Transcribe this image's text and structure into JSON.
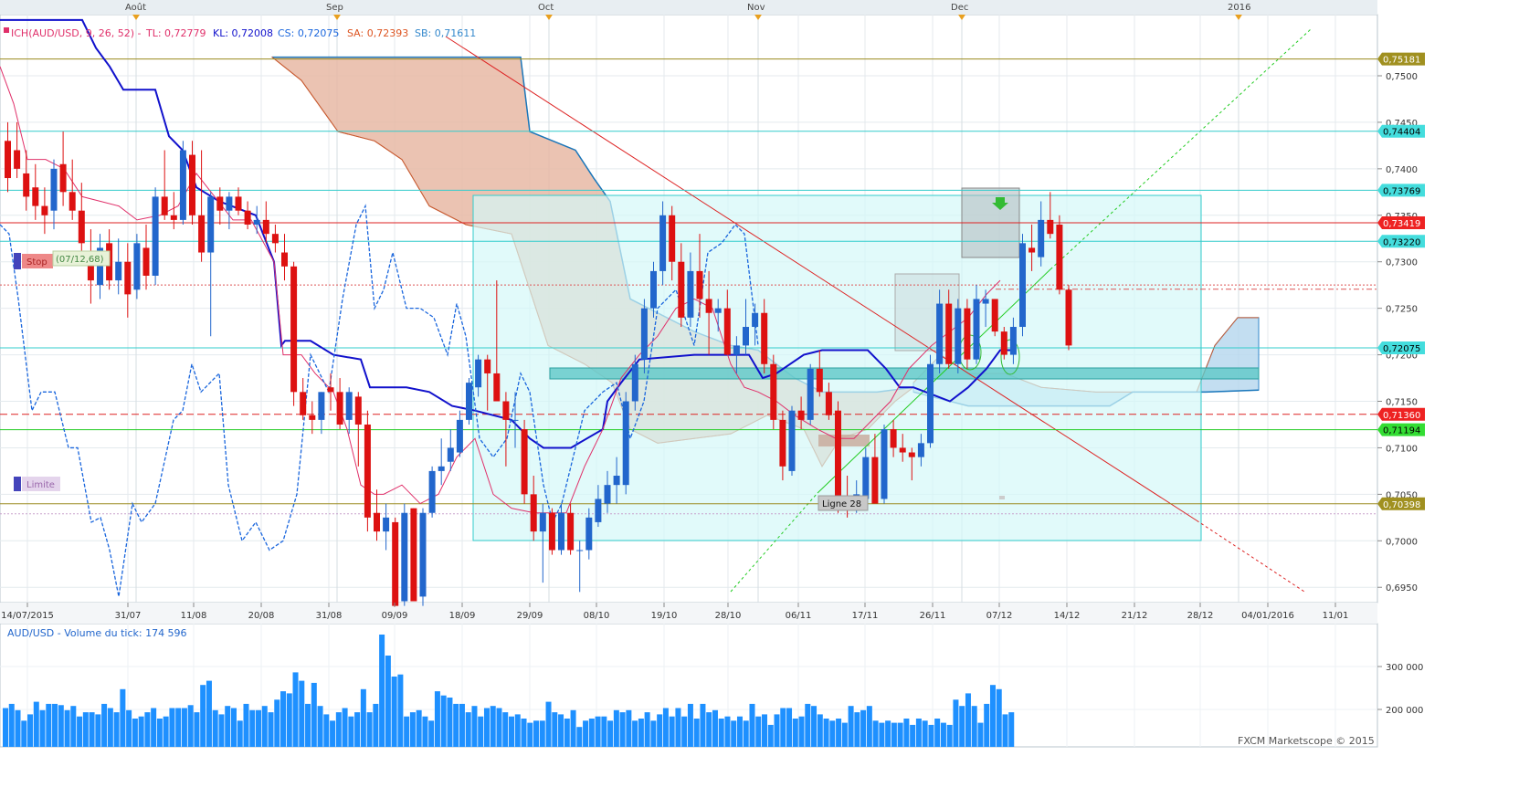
{
  "chart_data": {
    "type": "candlestick",
    "title": "ICH(AUD/USD, 9, 26, 52)",
    "indicator_readout": {
      "title": "ICH(AUD/USD, 9, 26, 52) -",
      "tl": "TL: 0,72779",
      "kl": "KL: 0,72008",
      "cs": "CS: 0,72075",
      "sa": "SA: 0,72393",
      "sb": "SB: 0,71611"
    },
    "month_labels": [
      "Août",
      "Sep",
      "Oct",
      "Nov",
      "Dec",
      "2016"
    ],
    "x_tick_labels": [
      "14/07/2015",
      "31/07",
      "11/08",
      "20/08",
      "31/08",
      "09/09",
      "18/09",
      "29/09",
      "08/10",
      "19/10",
      "28/10",
      "06/11",
      "17/11",
      "26/11",
      "07/12",
      "14/12",
      "21/12",
      "28/12",
      "04/01/2016",
      "11/01"
    ],
    "y_tick_labels": [
      "0,7500",
      "0,7450",
      "0,7400",
      "0,7350",
      "0,7300",
      "0,7250",
      "0,7200",
      "0,7150",
      "0,7100",
      "0,7050",
      "0,7000",
      "0,6950"
    ],
    "ylim": [
      0.6925,
      0.7545
    ],
    "price_levels": [
      {
        "value": 0.75181,
        "label": "0,75181",
        "color": "#9a8a1e"
      },
      {
        "value": 0.74404,
        "label": "0,74404",
        "color": "#33cccc"
      },
      {
        "value": 0.73769,
        "label": "0,73769",
        "color": "#33cccc"
      },
      {
        "value": 0.73419,
        "label": "0,73419",
        "color": "#dd2222"
      },
      {
        "value": 0.7322,
        "label": "0,73220",
        "color": "#33cccc"
      },
      {
        "value": 0.72075,
        "label": "0,72075",
        "color": "#33cccc"
      },
      {
        "value": 0.7136,
        "label": "0,71360",
        "color": "#dd2222"
      },
      {
        "value": 0.71194,
        "label": "0,71194",
        "color": "#22cc22"
      },
      {
        "value": 0.70398,
        "label": "0,70398",
        "color": "#9a8a1e"
      }
    ],
    "candles": [
      [
        0.743,
        0.745,
        0.7375,
        0.739
      ],
      [
        0.742,
        0.745,
        0.739,
        0.74
      ],
      [
        0.7395,
        0.742,
        0.7355,
        0.737
      ],
      [
        0.738,
        0.7405,
        0.7345,
        0.736
      ],
      [
        0.736,
        0.738,
        0.733,
        0.735
      ],
      [
        0.7355,
        0.741,
        0.7335,
        0.74
      ],
      [
        0.7405,
        0.744,
        0.736,
        0.7375
      ],
      [
        0.7375,
        0.741,
        0.7345,
        0.7355
      ],
      [
        0.7355,
        0.7385,
        0.73,
        0.732
      ],
      [
        0.731,
        0.7335,
        0.7255,
        0.728
      ],
      [
        0.7275,
        0.733,
        0.726,
        0.7315
      ],
      [
        0.732,
        0.7335,
        0.727,
        0.728
      ],
      [
        0.728,
        0.7325,
        0.7265,
        0.73
      ],
      [
        0.73,
        0.732,
        0.724,
        0.7265
      ],
      [
        0.727,
        0.733,
        0.726,
        0.732
      ],
      [
        0.7315,
        0.734,
        0.727,
        0.7285
      ],
      [
        0.7285,
        0.738,
        0.7275,
        0.737
      ],
      [
        0.737,
        0.742,
        0.7345,
        0.735
      ],
      [
        0.735,
        0.7375,
        0.7335,
        0.7345
      ],
      [
        0.7345,
        0.743,
        0.734,
        0.742
      ],
      [
        0.7415,
        0.743,
        0.734,
        0.735
      ],
      [
        0.735,
        0.742,
        0.73,
        0.731
      ],
      [
        0.731,
        0.7375,
        0.722,
        0.737
      ],
      [
        0.737,
        0.738,
        0.734,
        0.7355
      ],
      [
        0.7355,
        0.7375,
        0.7335,
        0.737
      ],
      [
        0.737,
        0.738,
        0.735,
        0.7355
      ],
      [
        0.7355,
        0.7365,
        0.7335,
        0.734
      ],
      [
        0.734,
        0.736,
        0.733,
        0.7345
      ],
      [
        0.7345,
        0.7365,
        0.732,
        0.733
      ],
      [
        0.733,
        0.734,
        0.731,
        0.732
      ],
      [
        0.731,
        0.733,
        0.728,
        0.7295
      ],
      [
        0.7295,
        0.73,
        0.7145,
        0.716
      ],
      [
        0.716,
        0.7175,
        0.713,
        0.7135
      ],
      [
        0.7135,
        0.715,
        0.7115,
        0.713
      ],
      [
        0.713,
        0.716,
        0.7115,
        0.716
      ],
      [
        0.7165,
        0.718,
        0.714,
        0.716
      ],
      [
        0.716,
        0.7175,
        0.712,
        0.7125
      ],
      [
        0.713,
        0.7165,
        0.7115,
        0.716
      ],
      [
        0.7155,
        0.716,
        0.708,
        0.7125
      ],
      [
        0.7125,
        0.714,
        0.701,
        0.7025
      ],
      [
        0.703,
        0.7055,
        0.7,
        0.701
      ],
      [
        0.701,
        0.704,
        0.699,
        0.7025
      ],
      [
        0.702,
        0.7025,
        0.693,
        0.693
      ],
      [
        0.6935,
        0.704,
        0.693,
        0.703
      ],
      [
        0.7035,
        0.7035,
        0.6935,
        0.6935
      ],
      [
        0.694,
        0.7035,
        0.693,
        0.703
      ],
      [
        0.703,
        0.708,
        0.7025,
        0.7075
      ],
      [
        0.7075,
        0.711,
        0.706,
        0.708
      ],
      [
        0.7085,
        0.712,
        0.7075,
        0.71
      ],
      [
        0.7095,
        0.714,
        0.709,
        0.713
      ],
      [
        0.713,
        0.7175,
        0.7125,
        0.717
      ],
      [
        0.7165,
        0.72,
        0.7155,
        0.7195
      ],
      [
        0.7195,
        0.72,
        0.714,
        0.718
      ],
      [
        0.718,
        0.728,
        0.717,
        0.715
      ],
      [
        0.715,
        0.716,
        0.708,
        0.713
      ],
      [
        0.713,
        0.716,
        0.71,
        0.713
      ],
      [
        0.712,
        0.713,
        0.704,
        0.705
      ],
      [
        0.705,
        0.707,
        0.7,
        0.701
      ],
      [
        0.701,
        0.704,
        0.6955,
        0.703
      ],
      [
        0.703,
        0.7035,
        0.6985,
        0.699
      ],
      [
        0.699,
        0.704,
        0.6985,
        0.703
      ],
      [
        0.703,
        0.704,
        0.6985,
        0.699
      ],
      [
        0.699,
        0.7,
        0.6945,
        0.699
      ],
      [
        0.699,
        0.7035,
        0.698,
        0.7025
      ],
      [
        0.702,
        0.706,
        0.7015,
        0.7045
      ],
      [
        0.704,
        0.7075,
        0.703,
        0.706
      ],
      [
        0.706,
        0.709,
        0.704,
        0.707
      ],
      [
        0.706,
        0.716,
        0.705,
        0.715
      ],
      [
        0.715,
        0.72,
        0.714,
        0.719
      ],
      [
        0.7195,
        0.726,
        0.718,
        0.725
      ],
      [
        0.725,
        0.73,
        0.724,
        0.729
      ],
      [
        0.729,
        0.7365,
        0.7275,
        0.735
      ],
      [
        0.735,
        0.736,
        0.728,
        0.73
      ],
      [
        0.73,
        0.732,
        0.723,
        0.724
      ],
      [
        0.724,
        0.731,
        0.723,
        0.729
      ],
      [
        0.729,
        0.733,
        0.724,
        0.726
      ],
      [
        0.726,
        0.729,
        0.72,
        0.7245
      ],
      [
        0.7245,
        0.726,
        0.7225,
        0.725
      ],
      [
        0.725,
        0.727,
        0.72,
        0.72
      ],
      [
        0.72,
        0.722,
        0.718,
        0.721
      ],
      [
        0.721,
        0.726,
        0.72,
        0.723
      ],
      [
        0.723,
        0.7255,
        0.721,
        0.7245
      ],
      [
        0.7245,
        0.726,
        0.718,
        0.719
      ],
      [
        0.719,
        0.72,
        0.712,
        0.713
      ],
      [
        0.713,
        0.714,
        0.7065,
        0.708
      ],
      [
        0.7075,
        0.7145,
        0.707,
        0.714
      ],
      [
        0.714,
        0.7155,
        0.712,
        0.713
      ],
      [
        0.713,
        0.719,
        0.7125,
        0.7185
      ],
      [
        0.7185,
        0.7205,
        0.7155,
        0.716
      ],
      [
        0.716,
        0.717,
        0.713,
        0.7135
      ],
      [
        0.714,
        0.715,
        0.703,
        0.7045
      ],
      [
        0.7045,
        0.707,
        0.7025,
        0.7035
      ],
      [
        0.7035,
        0.7065,
        0.703,
        0.705
      ],
      [
        0.7045,
        0.71,
        0.704,
        0.709
      ],
      [
        0.709,
        0.7115,
        0.704,
        0.704
      ],
      [
        0.7045,
        0.7125,
        0.704,
        0.712
      ],
      [
        0.712,
        0.713,
        0.709,
        0.71
      ],
      [
        0.71,
        0.7115,
        0.7085,
        0.7095
      ],
      [
        0.7095,
        0.71,
        0.7065,
        0.709
      ],
      [
        0.709,
        0.7115,
        0.708,
        0.7105
      ],
      [
        0.7105,
        0.72,
        0.71,
        0.719
      ],
      [
        0.719,
        0.727,
        0.718,
        0.7255
      ],
      [
        0.7255,
        0.727,
        0.7185,
        0.719
      ],
      [
        0.719,
        0.726,
        0.718,
        0.725
      ],
      [
        0.725,
        0.726,
        0.7185,
        0.7195
      ],
      [
        0.7195,
        0.7275,
        0.719,
        0.726
      ],
      [
        0.7255,
        0.727,
        0.723,
        0.726
      ],
      [
        0.726,
        0.726,
        0.722,
        0.7225
      ],
      [
        0.7225,
        0.723,
        0.7195,
        0.72
      ],
      [
        0.72,
        0.724,
        0.719,
        0.723
      ],
      [
        0.723,
        0.733,
        0.722,
        0.732
      ],
      [
        0.7315,
        0.734,
        0.729,
        0.731
      ],
      [
        0.7305,
        0.7365,
        0.7295,
        0.7345
      ],
      [
        0.7345,
        0.7375,
        0.7325,
        0.733
      ],
      [
        0.734,
        0.735,
        0.7265,
        0.727
      ],
      [
        0.727,
        0.7275,
        0.7205,
        0.721
      ]
    ],
    "volume": {
      "label": "AUD/USD - Volume du tick: 174 596",
      "y_tick_labels": [
        "300 000",
        "200 000"
      ],
      "ylim": [
        130000,
        400000
      ],
      "values": [
        205000,
        215000,
        200000,
        175000,
        190000,
        220000,
        200000,
        215000,
        215000,
        212000,
        200000,
        210000,
        185000,
        195000,
        195000,
        190000,
        215000,
        205000,
        195000,
        250000,
        200000,
        180000,
        185000,
        195000,
        205000,
        180000,
        185000,
        205000,
        205000,
        205000,
        212000,
        195000,
        260000,
        270000,
        200000,
        190000,
        210000,
        205000,
        175000,
        215000,
        200000,
        200000,
        210000,
        195000,
        225000,
        245000,
        240000,
        290000,
        270000,
        215000,
        265000,
        210000,
        190000,
        175000,
        195000,
        205000,
        185000,
        195000,
        250000,
        195000,
        215000,
        380000,
        330000,
        280000,
        285000,
        185000,
        195000,
        200000,
        185000,
        175000,
        245000,
        235000,
        230000,
        215000,
        215000,
        195000,
        210000,
        185000,
        205000,
        210000,
        205000,
        195000,
        185000,
        190000,
        180000,
        170000,
        175000,
        175000,
        220000,
        195000,
        190000,
        180000,
        200000,
        160000,
        175000,
        180000,
        185000,
        185000,
        175000,
        200000,
        195000,
        200000,
        175000,
        180000,
        195000,
        175000,
        190000,
        205000,
        185000,
        205000,
        185000,
        215000,
        180000,
        215000,
        195000,
        200000,
        180000,
        185000,
        175000,
        185000,
        175000,
        215000,
        185000,
        190000,
        165000,
        190000,
        205000,
        205000,
        180000,
        185000,
        215000,
        210000,
        190000,
        180000,
        175000,
        180000,
        170000,
        210000,
        195000,
        200000,
        210000,
        175000,
        170000,
        175000,
        170000,
        170000,
        180000,
        165000,
        180000,
        175000,
        165000,
        180000,
        170000,
        165000,
        225000,
        210000,
        240000,
        210000,
        170000,
        215000,
        260000,
        250000,
        190000,
        195000
      ]
    },
    "annotations": {
      "stop_label": "Stop",
      "stop_value": "(07/12,68)",
      "limite_label": "Limite",
      "ligne_label": "Ligne 28",
      "copyright": "FXCM Marketscope © 2015"
    },
    "colors": {
      "bull": "#2266cc",
      "bear": "#dd1111",
      "tenkan": "#e0306a",
      "kijun": "#1111cc",
      "chikou": "#1a66dd",
      "cloud_bear": "#e8b9a4",
      "cloud_bull": "#b8d8ee",
      "rect_fill": "#d4f8f8",
      "rect_stroke": "#33cccc"
    },
    "legend": "top-left",
    "grid": true
  }
}
